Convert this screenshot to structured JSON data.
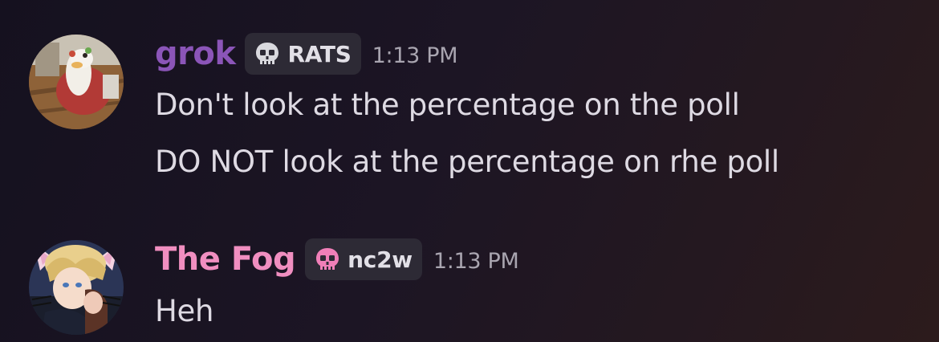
{
  "colors": {
    "grok_name": "#8b55b8",
    "fog_name": "#f08ec0",
    "tag_bg": "#2d2a35",
    "timestamp": "#a9a5b0",
    "message_text": "#dedae3"
  },
  "messages": [
    {
      "author": "grok",
      "tag": {
        "icon": "skull-icon",
        "label": "RATS"
      },
      "timestamp": "1:13 PM",
      "lines": [
        "Don't look at the percentage on the poll",
        "DO NOT look at the percentage on rhe poll"
      ]
    },
    {
      "author": "The Fog",
      "tag": {
        "icon": "pink-skull-icon",
        "label": "nc2w"
      },
      "timestamp": "1:13 PM",
      "lines": [
        "Heh"
      ]
    }
  ]
}
